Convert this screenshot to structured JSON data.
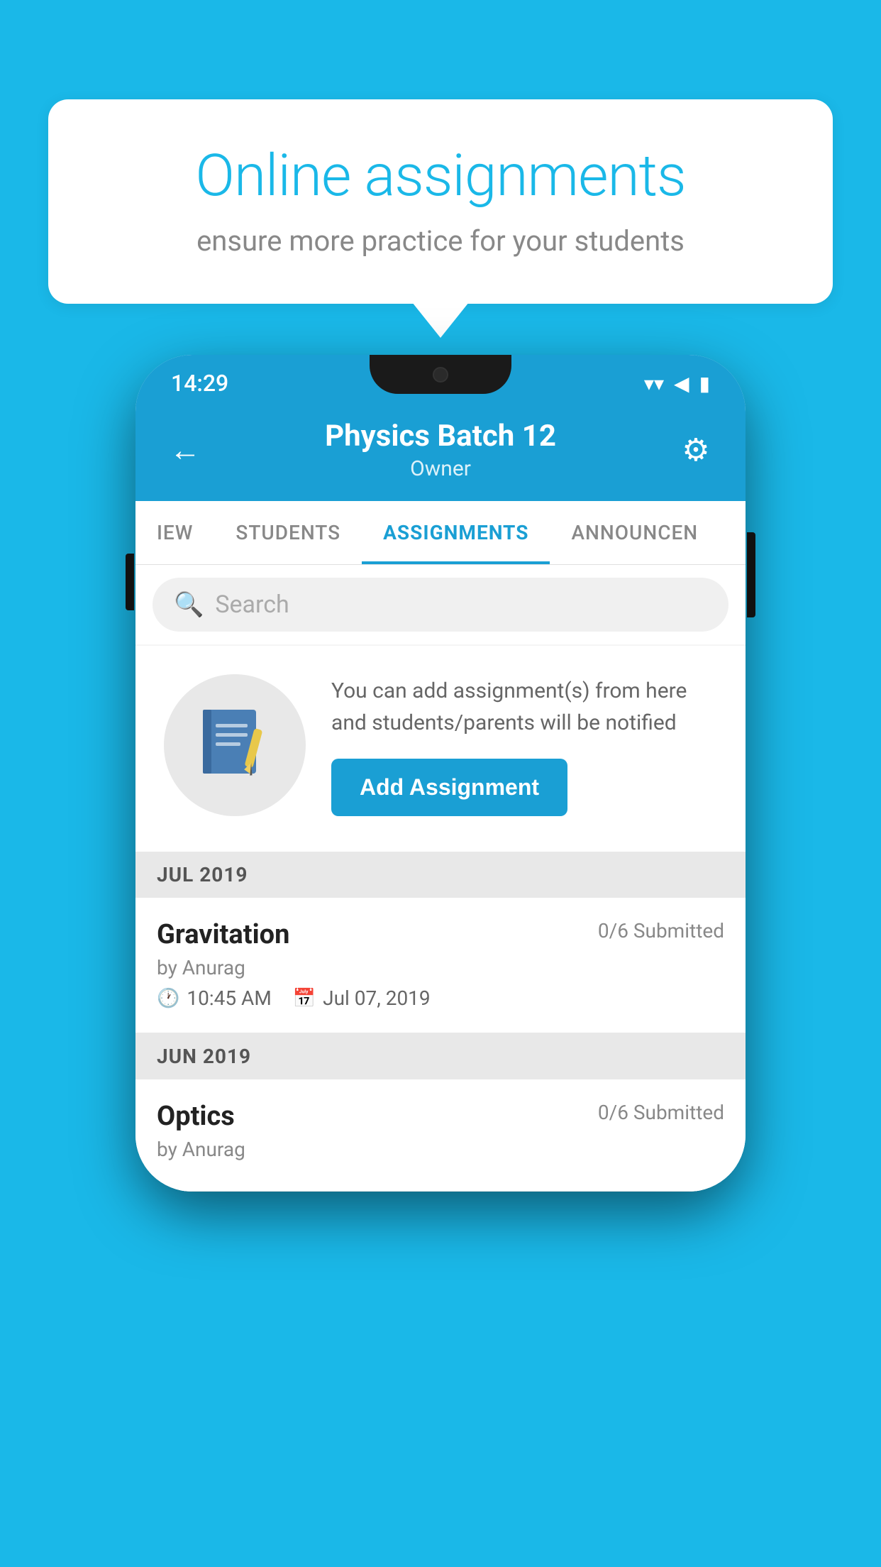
{
  "background_color": "#1ab8e8",
  "speech_bubble": {
    "title": "Online assignments",
    "subtitle": "ensure more practice for your students"
  },
  "phone": {
    "status_bar": {
      "time": "14:29",
      "wifi": "▼",
      "signal": "◀",
      "battery": "▮"
    },
    "header": {
      "back_label": "←",
      "title": "Physics Batch 12",
      "subtitle": "Owner",
      "settings_label": "⚙"
    },
    "tabs": [
      {
        "label": "IEW",
        "active": false
      },
      {
        "label": "STUDENTS",
        "active": false
      },
      {
        "label": "ASSIGNMENTS",
        "active": true
      },
      {
        "label": "ANNOUNCEN",
        "active": false
      }
    ],
    "search": {
      "placeholder": "Search"
    },
    "promo": {
      "text": "You can add assignment(s) from here and students/parents will be notified",
      "button_label": "Add Assignment"
    },
    "sections": [
      {
        "label": "JUL 2019",
        "assignments": [
          {
            "name": "Gravitation",
            "submitted": "0/6 Submitted",
            "by": "by Anurag",
            "time": "10:45 AM",
            "date": "Jul 07, 2019"
          }
        ]
      },
      {
        "label": "JUN 2019",
        "assignments": [
          {
            "name": "Optics",
            "submitted": "0/6 Submitted",
            "by": "by Anurag",
            "time": "",
            "date": ""
          }
        ]
      }
    ]
  }
}
